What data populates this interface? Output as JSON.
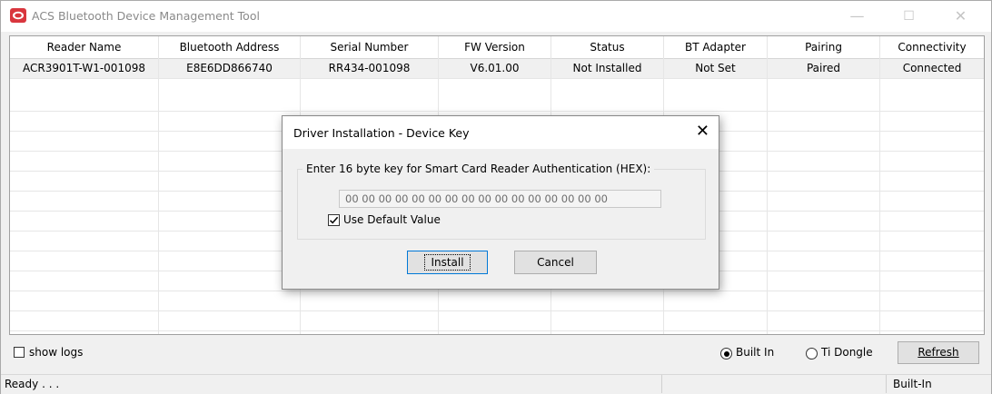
{
  "window": {
    "title": "ACS Bluetooth Device Management Tool",
    "controls": {
      "minimize": "—",
      "maximize": "☐",
      "close": "✕"
    }
  },
  "grid": {
    "columns": [
      "Reader Name",
      "Bluetooth Address",
      "Serial Number",
      "FW Version",
      "Status",
      "BT Adapter",
      "Pairing",
      "Connectivity"
    ],
    "rows": [
      [
        "ACR3901T-W1-001098",
        "E8E6DD866740",
        "RR434-001098",
        "V6.01.00",
        "Not Installed",
        "Not Set",
        "Paired",
        "Connected"
      ]
    ]
  },
  "bottom": {
    "show_logs_label": "show logs",
    "show_logs_checked": false,
    "radio_builtin_label": "Built In",
    "radio_tidongle_label": "Ti Dongle",
    "selected_radio": "Built In",
    "refresh_label": "Refresh"
  },
  "statusbar": {
    "left": "Ready . . .",
    "right": "Built-In"
  },
  "dialog": {
    "title": "Driver Installation - Device Key",
    "prompt": "Enter 16 byte key for Smart Card Reader Authentication (HEX):",
    "key_value": "00 00 00 00 00 00 00 00 00 00 00 00 00 00 00 00",
    "use_default_label": "Use Default Value",
    "use_default_checked": true,
    "install_label": "Install",
    "cancel_label": "Cancel",
    "close_glyph": "✕"
  },
  "colors": {
    "app_icon_red": "#d9363e",
    "window_bg": "#f0f0f0",
    "selected_row": "#f0f0f0",
    "title_inactive_text": "#8a8a8a"
  }
}
